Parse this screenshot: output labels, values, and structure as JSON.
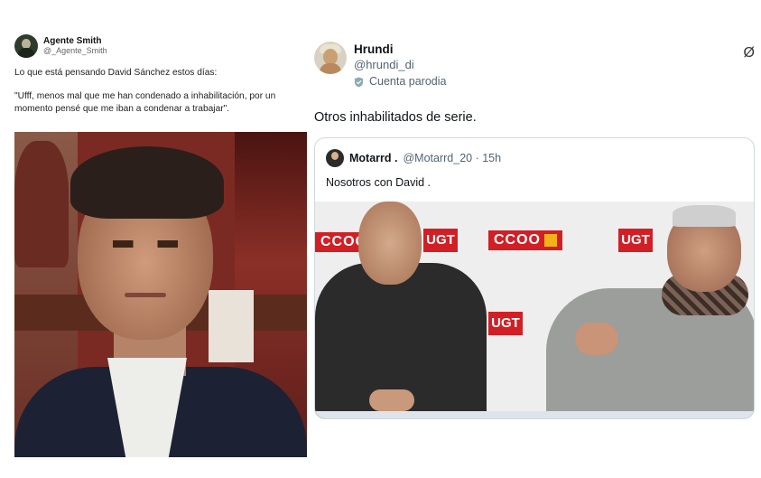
{
  "left_tweet": {
    "name": "Agente Smith",
    "handle": "@_Agente_Smith",
    "text_intro": "Lo que está pensando David Sánchez estos días:",
    "text_quote": "\"Ufff, menos mal que me han condenado a inhabilitación, por un momento pensé que me iban a condenar a trabajar\"."
  },
  "right_tweet": {
    "name": "Hrundi",
    "handle": "@hrundi_di",
    "parody_label": "Cuenta parodia",
    "text": "Otros inhabilitados de serie.",
    "grok_icon": "Ø",
    "quoted": {
      "name": "Motarrd .",
      "meta": "@Motarrd_20 · 15h",
      "text": "Nosotros con David .",
      "logos": {
        "ccoo": "CCOO",
        "ugt": "UGT"
      }
    }
  },
  "colors": {
    "brand_red": "#d21f26",
    "meta_gray": "#536471",
    "border": "#cfd9de"
  }
}
